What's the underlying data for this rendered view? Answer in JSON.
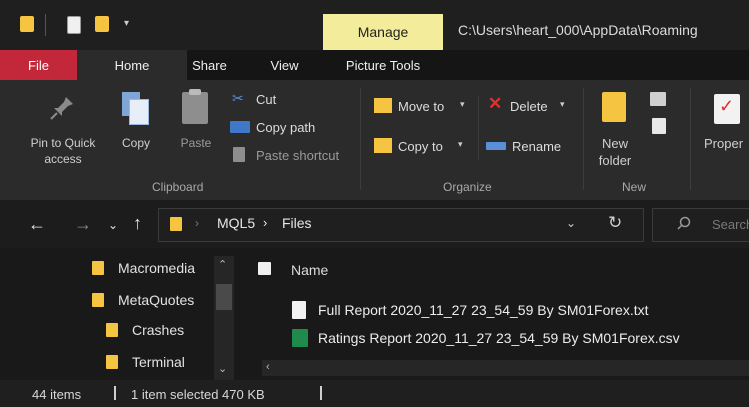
{
  "titlebar": {
    "manage_label": "Manage",
    "path": "C:\\Users\\heart_000\\AppData\\Roaming"
  },
  "tabs": [
    "File",
    "Home",
    "Share",
    "View",
    "Picture Tools"
  ],
  "ribbon": {
    "clipboard": {
      "pin_label_1": "Pin to Quick",
      "pin_label_2": "access",
      "copy": "Copy",
      "paste": "Paste",
      "cut": "Cut",
      "copy_path": "Copy path",
      "paste_shortcut": "Paste shortcut",
      "group": "Clipboard"
    },
    "organize": {
      "move_to": "Move to",
      "copy_to": "Copy to",
      "delete": "Delete",
      "rename": "Rename",
      "group": "Organize"
    },
    "new": {
      "new_folder_1": "New",
      "new_folder_2": "folder",
      "group": "New"
    },
    "open": {
      "properties": "Proper"
    }
  },
  "address": {
    "segments": [
      "MQL5",
      "Files"
    ],
    "search_placeholder": "Search"
  },
  "nav": {
    "items": [
      "Macromedia",
      "MetaQuotes",
      "Crashes",
      "Terminal"
    ]
  },
  "filelist": {
    "header": "Name",
    "files": [
      "Full Report 2020_11_27 23_54_59 By SM01Forex.txt",
      "Ratings Report 2020_11_27 23_54_59 By SM01Forex.csv"
    ]
  },
  "status": {
    "items": "44 items",
    "selected": "1 item selected  470 KB"
  },
  "colors": {
    "accent_file": "#c2273a",
    "manage": "#f3ec9a",
    "folder": "#f5c542",
    "delete": "#e03030"
  }
}
